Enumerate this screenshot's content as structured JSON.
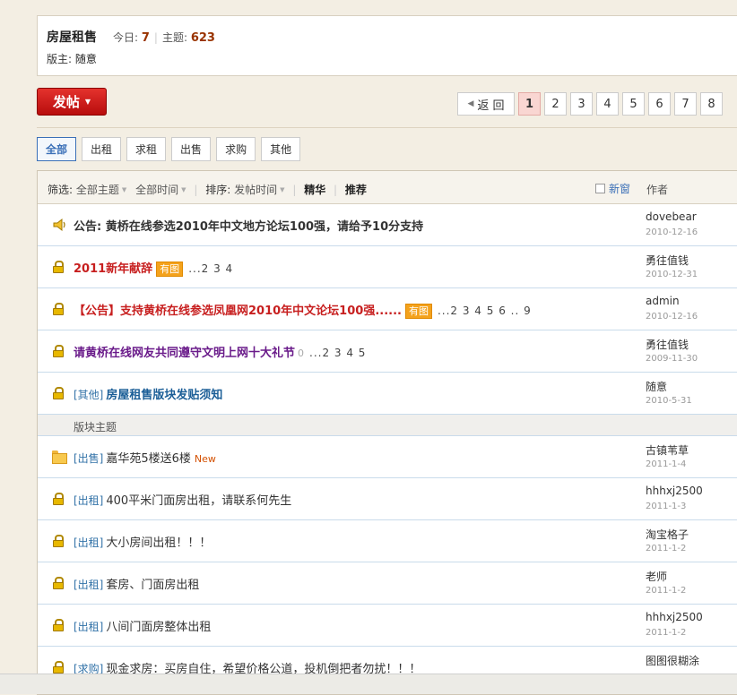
{
  "forum": {
    "title": "房屋租售",
    "today_label": "今日:",
    "today_value": "7",
    "topics_label": "主题:",
    "topics_value": "623",
    "moderator_label": "版主:",
    "moderator_name": "随意"
  },
  "post_button": {
    "label": "发帖"
  },
  "pager": {
    "back_label": "返 回",
    "pages": [
      "1",
      "2",
      "3",
      "4",
      "5",
      "6",
      "7",
      "8"
    ],
    "current": "1"
  },
  "type_tabs": [
    "全部",
    "出租",
    "求租",
    "出售",
    "求购",
    "其他"
  ],
  "filter_bar": {
    "filter_label": "筛选:",
    "all_topics": "全部主题",
    "all_time": "全部时间",
    "sort_label": "排序:",
    "sort_value": "发帖时间",
    "digest": "精华",
    "recommend": "推荐",
    "new_window": "新窗",
    "author_header": "作者"
  },
  "sticky_threads": [
    {
      "icon": "announcement-icon",
      "prefix": "公告:",
      "title": "黄桥在线参选2010年中文地方论坛100强，请给予10分支持",
      "author": "dovebear",
      "date": "2010-12-16"
    },
    {
      "icon": "lock-icon",
      "title": "2011新年献辞",
      "tag": "有图",
      "pages": "...2 3 4",
      "author": "勇往值钱",
      "date": "2010-12-31"
    },
    {
      "icon": "lock-icon",
      "title": "【公告】支持黄桥在线参选凤凰网2010年中文论坛100强......",
      "tag": "有图",
      "pages": "...2 3 4 5 6 .. 9",
      "author": "admin",
      "date": "2010-12-16"
    },
    {
      "icon": "lock-icon",
      "title": "请黄桥在线网友共同遵守文明上网十大礼节",
      "pages": "...2 3 4 5",
      "author": "勇往值钱",
      "date": "2009-11-30"
    },
    {
      "icon": "lock-icon",
      "category": "[其他]",
      "title": "房屋租售版块发贴须知",
      "author": "随意",
      "date": "2010-5-31"
    }
  ],
  "section_header": "版块主题",
  "threads": [
    {
      "icon": "folder-icon",
      "category": "[出售]",
      "title": "嘉华苑5楼送6楼",
      "new_label": "New",
      "author": "古镇苇草",
      "date": "2011-1-4"
    },
    {
      "icon": "lock-icon",
      "category": "[出租]",
      "title": "400平米门面房出租，请联系何先生",
      "author": "hhhxj2500",
      "date": "2011-1-3"
    },
    {
      "icon": "lock-icon",
      "category": "[出租]",
      "title": "大小房间出租！！！",
      "author": "淘宝格子",
      "date": "2011-1-2"
    },
    {
      "icon": "lock-icon",
      "category": "[出租]",
      "title": "套房、门面房出租",
      "author": "老师",
      "date": "2011-1-2"
    },
    {
      "icon": "lock-icon",
      "category": "[出租]",
      "title": "八间门面房整体出租",
      "author": "hhhxj2500",
      "date": "2011-1-2"
    },
    {
      "icon": "lock-icon",
      "category": "[求购]",
      "title": "现金求房：买房自住，希望价格公道，投机倒把者勿扰！！！",
      "author": "图图很糊涂",
      "date": ""
    }
  ]
}
